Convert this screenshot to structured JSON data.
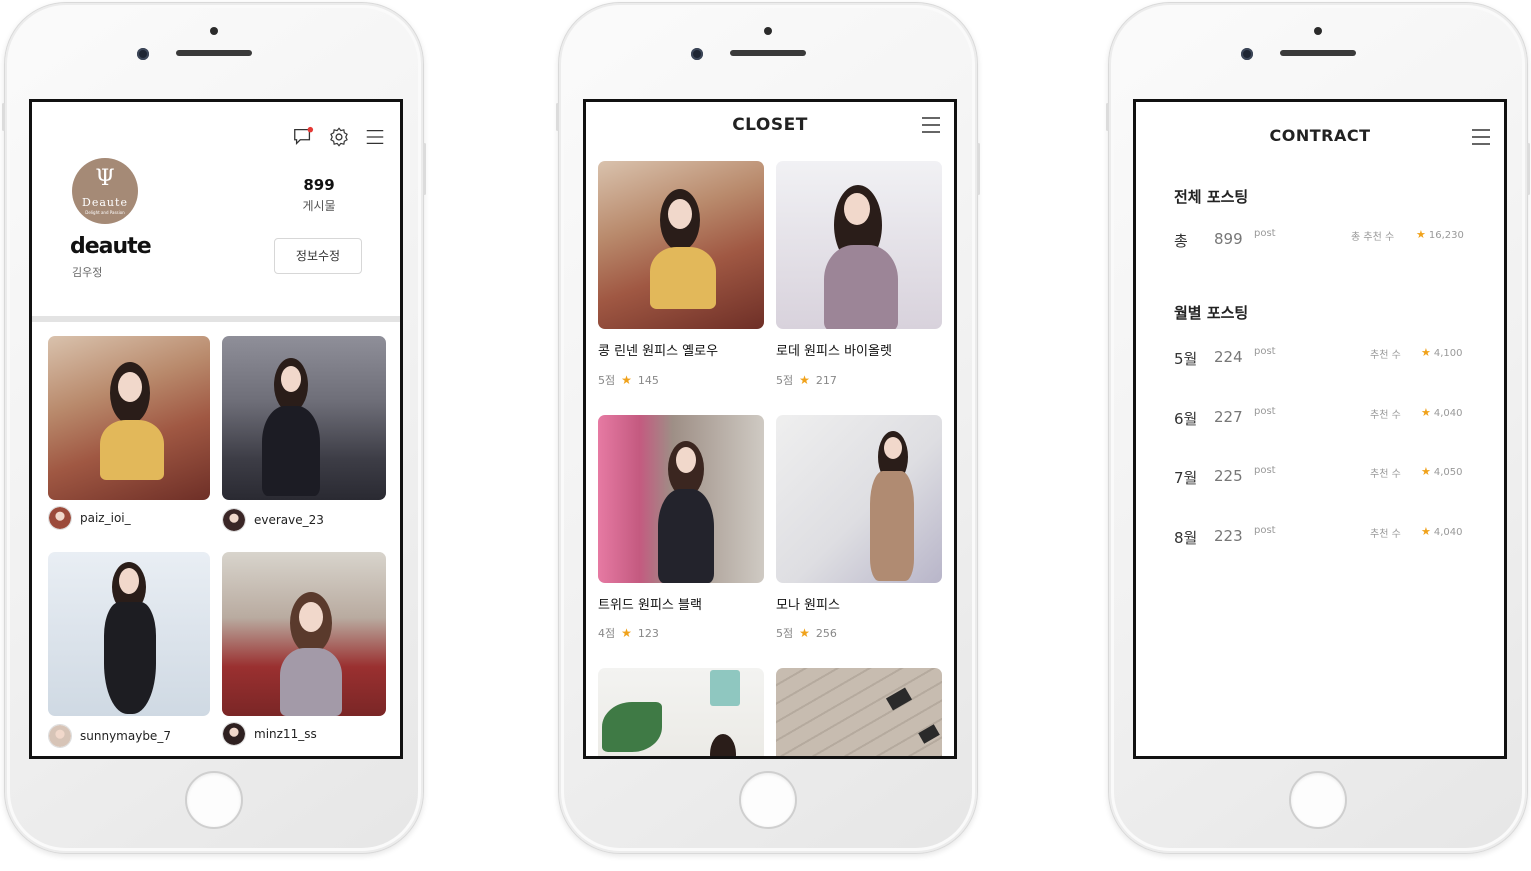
{
  "profile": {
    "logo_monogram": "Ψ",
    "logo_word": "Deaute",
    "logo_tagline": "Delight and Passion",
    "posts_count": "899",
    "posts_label": "게시물",
    "username": "deaute",
    "real_name": "김우정",
    "edit_button": "정보수정",
    "feed": [
      {
        "user": "paiz_ioi_"
      },
      {
        "user": "everave_23"
      },
      {
        "user": "sunnymaybe_7"
      },
      {
        "user": "minz11_ss"
      }
    ]
  },
  "closet": {
    "title": "CLOSET",
    "items": [
      {
        "name": "콩 린넨 원피스 옐로우",
        "score": "5점",
        "likes": "145"
      },
      {
        "name": "로데 원피스 바이올렛",
        "score": "5점",
        "likes": "217"
      },
      {
        "name": "트위드 원피스 블랙",
        "score": "4점",
        "likes": "123"
      },
      {
        "name": "모나 원피스",
        "score": "5점",
        "likes": "256"
      }
    ]
  },
  "contract": {
    "title": "CONTRACT",
    "total_section": "전체 포스팅",
    "total": {
      "label": "총",
      "count": "899",
      "unit": "post",
      "rec_label": "총 추천 수",
      "rec_value": "16,230"
    },
    "monthly_section": "월별 포스팅",
    "monthly": [
      {
        "label": "5월",
        "count": "224",
        "unit": "post",
        "rec_label": "추천 수",
        "rec_value": "4,100"
      },
      {
        "label": "6월",
        "count": "227",
        "unit": "post",
        "rec_label": "추천 수",
        "rec_value": "4,040"
      },
      {
        "label": "7월",
        "count": "225",
        "unit": "post",
        "rec_label": "추천 수",
        "rec_value": "4,050"
      },
      {
        "label": "8월",
        "count": "223",
        "unit": "post",
        "rec_label": "추천 수",
        "rec_value": "4,040"
      }
    ]
  },
  "colors": {
    "accent_star": "#f0a21b",
    "notification_dot": "#e53935",
    "logo_bg": "#a58a76"
  },
  "icons": [
    "chat-icon",
    "gear-icon",
    "menu-icon",
    "star-icon"
  ]
}
